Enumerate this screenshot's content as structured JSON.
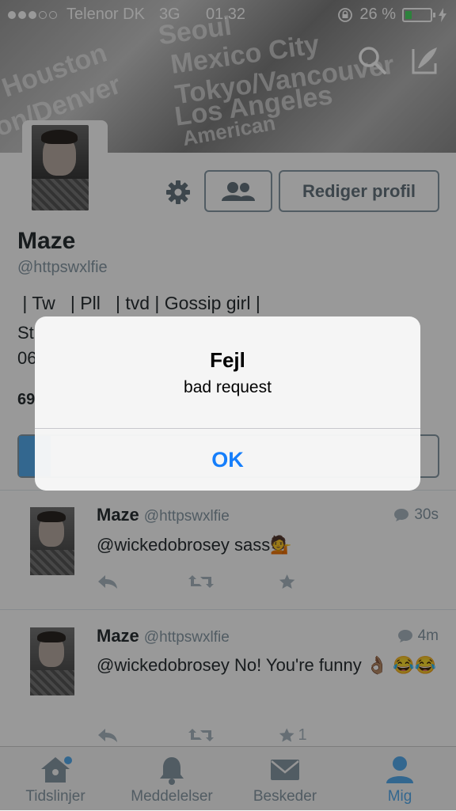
{
  "status_bar": {
    "carrier": "Telenor DK",
    "network": "3G",
    "time": "01.32",
    "battery_percent": "26 %",
    "battery_level": 0.26,
    "signal_bars": 3
  },
  "header": {
    "cover_words": [
      "Seoul",
      "Mexico City",
      "Tokyo/Vancouver",
      "Los Angeles",
      "Houston",
      "on/Denver",
      "American"
    ]
  },
  "profile": {
    "name": "Maze",
    "handle": "@httpswxlfie",
    "bio_line1": " | Tw   | Pll   | tvd | Gossip girl |",
    "bio_line2": "St",
    "bio_line3": "06",
    "stat": "69",
    "edit_button": "Rediger profil"
  },
  "tweets": [
    {
      "name": "Maze",
      "handle": "@httpswxlfie",
      "time": "30s",
      "text": "@wickedobrosey sass💁",
      "favorites": ""
    },
    {
      "name": "Maze",
      "handle": "@httpswxlfie",
      "time": "4m",
      "text": "@wickedobrosey No! You're funny 👌🏽 😂😂",
      "favorites": "1"
    }
  ],
  "tab_bar": {
    "tabs": [
      {
        "label": "Tidslinjer",
        "icon": "home-icon"
      },
      {
        "label": "Meddelelser",
        "icon": "bell-icon"
      },
      {
        "label": "Beskeder",
        "icon": "envelope-icon"
      },
      {
        "label": "Mig",
        "icon": "person-icon"
      }
    ],
    "active_index": 3
  },
  "alert": {
    "title": "Fejl",
    "message": "bad request",
    "ok_label": "OK"
  },
  "colors": {
    "accent": "#55acee",
    "ios_blue": "#157efb",
    "gray": "#8899a6"
  }
}
